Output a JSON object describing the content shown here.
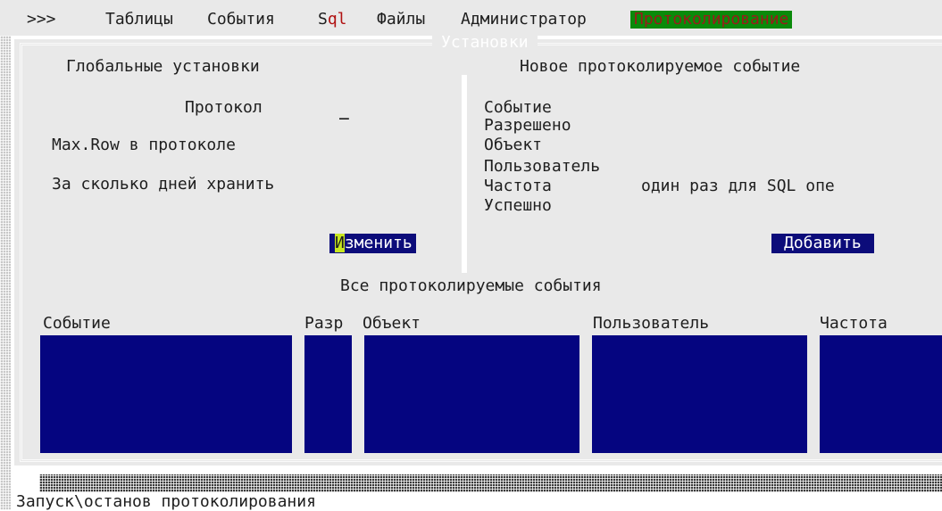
{
  "menu": {
    "prompt": ">>>",
    "items": [
      "Таблицы",
      "События"
    ],
    "sql_s": "S",
    "sql_rest": "ql",
    "items2": [
      "Файлы",
      "Администратор"
    ],
    "active": "Протоколирование"
  },
  "window": {
    "title": "Установки"
  },
  "global": {
    "header": "Глобальные установки",
    "protocol_label": "Протокол",
    "protocol_value": "_",
    "maxrow_label": "Max.Row в протоколе",
    "days_label": "За сколько дней хранить",
    "change_hot": "И",
    "change_rest": "зменить"
  },
  "new_event": {
    "header": "Новое протоколируемое событие",
    "event_label": "Событие",
    "allowed_label": "Разрешено",
    "object_label": "Объект",
    "user_label": "Пользователь",
    "freq_label": "Частота",
    "freq_value": "один раз для SQL опе",
    "success_label": "Успешно",
    "add_button": "Добавить"
  },
  "all_events": {
    "header": "Все протоколируемые события",
    "columns": [
      "Событие",
      "Разр",
      "Объект",
      "Пользователь",
      "Частота"
    ]
  },
  "status": {
    "text": "Запуск\\останов протоколирования"
  },
  "colors": {
    "panel": "#e9e9e9",
    "table_fill": "#050580",
    "button": "#0c0c7a",
    "active_menu": "#0a8a0a",
    "hotkey": "#c8e620"
  }
}
